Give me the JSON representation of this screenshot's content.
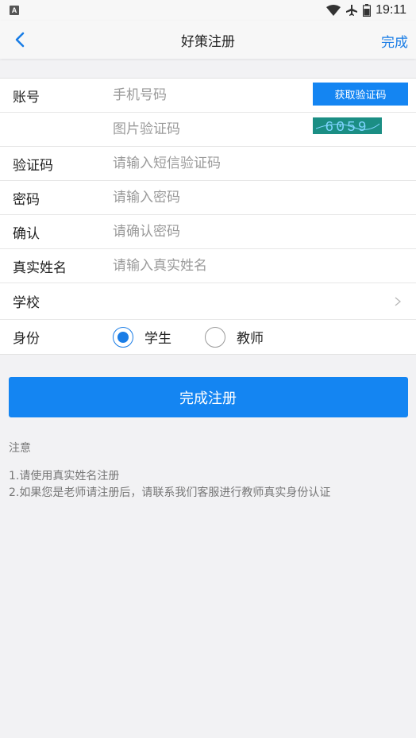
{
  "status_bar": {
    "time": "19:11",
    "app_badge": "A"
  },
  "nav": {
    "title": "好策注册",
    "done_label": "完成"
  },
  "form": {
    "account": {
      "label": "账号",
      "placeholder": "手机号码",
      "sms_button": "获取验证码"
    },
    "captcha": {
      "placeholder": "图片验证码",
      "image_text": "6059"
    },
    "verify_code": {
      "label": "验证码",
      "placeholder": "请输入短信验证码"
    },
    "password": {
      "label": "密码",
      "placeholder": "请输入密码"
    },
    "confirm": {
      "label": "确认",
      "placeholder": "请确认密码"
    },
    "real_name": {
      "label": "真实姓名",
      "placeholder": "请输入真实姓名"
    },
    "school": {
      "label": "学校",
      "value": ""
    },
    "identity": {
      "label": "身份",
      "options": [
        {
          "label": "学生",
          "selected": true
        },
        {
          "label": "教师",
          "selected": false
        }
      ]
    }
  },
  "submit_label": "完成注册",
  "notes": {
    "title": "注意",
    "lines": [
      "1.请使用真实姓名注册",
      "2.如果您是老师请注册后，请联系我们客服进行教师真实身份认证"
    ]
  },
  "colors": {
    "accent": "#1485f2",
    "captcha_bg": "#1b8e84",
    "background": "#f2f2f4"
  },
  "icons": [
    "wifi-icon",
    "airplane-icon",
    "battery-icon",
    "back-chevron-icon",
    "chevron-right-icon"
  ]
}
